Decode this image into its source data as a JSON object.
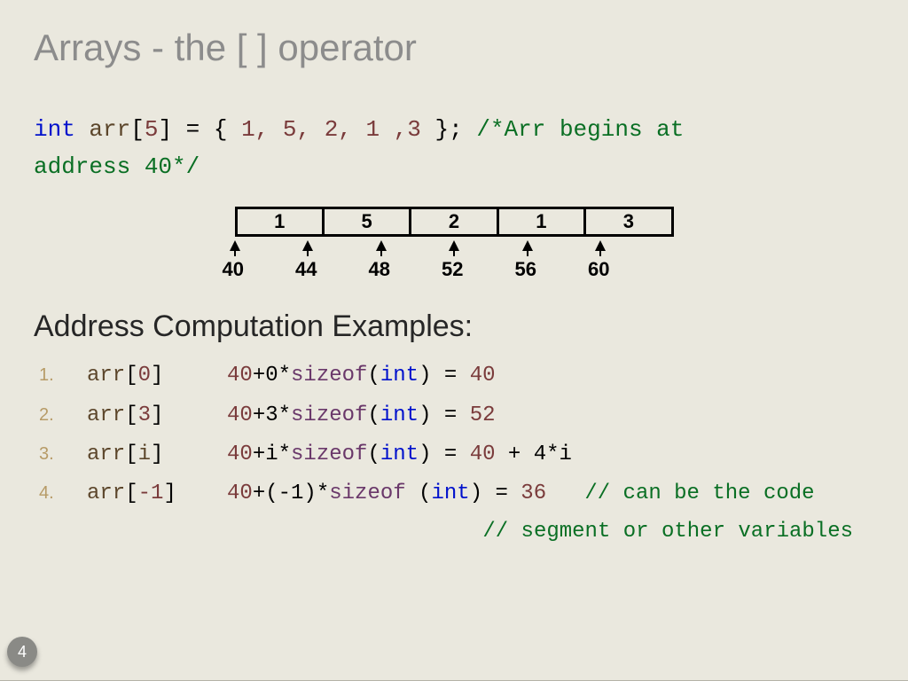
{
  "title": "Arrays - the [ ] operator",
  "declaration": {
    "type_kw": "int",
    "name": "arr",
    "size": "5",
    "eq": " = { ",
    "values": "1, 5, 2, 1 ,3",
    "tail": "  }; ",
    "comment1": "/*Arr begins at",
    "comment2": "address 40*/"
  },
  "array_cells": [
    "1",
    "5",
    "2",
    "1",
    "3"
  ],
  "addresses": [
    "40",
    "44",
    "48",
    "52",
    "56",
    "60"
  ],
  "subheading": "Address Computation Examples:",
  "examples": [
    {
      "n": "1.",
      "expr_name": "arr",
      "expr_idx": "0",
      "calc_a": "40",
      "calc_b": "+0*",
      "calc_fn": "sizeof",
      "calc_c": "(",
      "calc_ty": "int",
      "calc_d": ") = ",
      "calc_res": "40",
      "rest": ""
    },
    {
      "n": "2.",
      "expr_name": "arr",
      "expr_idx": "3",
      "calc_a": "40",
      "calc_b": "+3*",
      "calc_fn": "sizeof",
      "calc_c": "(",
      "calc_ty": "int",
      "calc_d": ") = ",
      "calc_res": "52",
      "rest": ""
    },
    {
      "n": "3.",
      "expr_name": "arr",
      "expr_idx": "i",
      "calc_a": "40",
      "calc_b": "+i*",
      "calc_fn": "sizeof",
      "calc_c": "(",
      "calc_ty": "int",
      "calc_d": ") = ",
      "calc_res": "40",
      "rest": " + 4*i"
    },
    {
      "n": "4.",
      "expr_name": "arr",
      "expr_idx": "-1",
      "calc_a": "40",
      "calc_b": "+(-1)*",
      "calc_fn": "sizeof",
      "calc_c": " (",
      "calc_ty": "int",
      "calc_d": ") = ",
      "calc_res": "36",
      "rest": "   ",
      "comment": "// can be the code"
    }
  ],
  "trailing_comment": "// segment or other variables",
  "page": "4"
}
